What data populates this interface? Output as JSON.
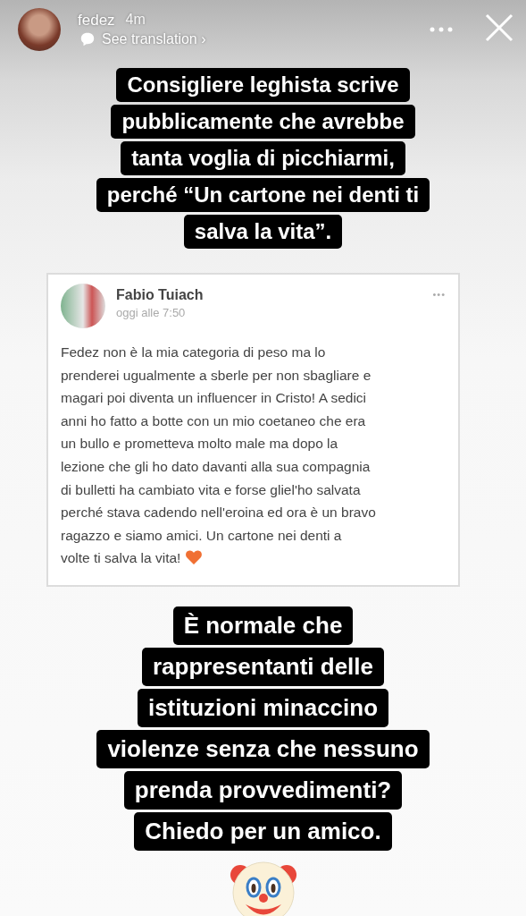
{
  "header": {
    "username": "fedez",
    "time": "4m",
    "translation_link": "See translation ›"
  },
  "caption_top": {
    "lines": [
      "Consigliere leghista scrive",
      "pubblicamente che avrebbe",
      "tanta voglia di picchiarmi,",
      "perché “Un cartone nei denti ti",
      "salva la vita”."
    ]
  },
  "post": {
    "author": "Fabio Tuiach",
    "time": "oggi alle 7:50",
    "more": "•••",
    "body_lines": [
      "Fedez non è la mia categoria di peso ma lo",
      "prenderei ugualmente a sberle per non sbagliare e",
      "magari poi diventa un influencer in Cristo! A sedici",
      "anni ho fatto a botte con un mio coetaneo che era",
      "un bullo e prometteva molto male ma dopo la",
      "lezione che gli ho dato davanti alla sua compagnia",
      "di bulletti ha cambiato vita e forse gliel'ho salvata",
      "perché stava cadendo nell'eroina ed ora è un bravo",
      "ragazzo e siamo amici. Un cartone nei denti a",
      "volte ti salva la vita!"
    ]
  },
  "caption_bottom": {
    "lines": [
      "È normale che",
      "rappresentanti delle",
      "istituzioni minaccino",
      "violenze senza che nessuno",
      "prenda provvedimenti?",
      "Chiedo per un amico."
    ]
  }
}
